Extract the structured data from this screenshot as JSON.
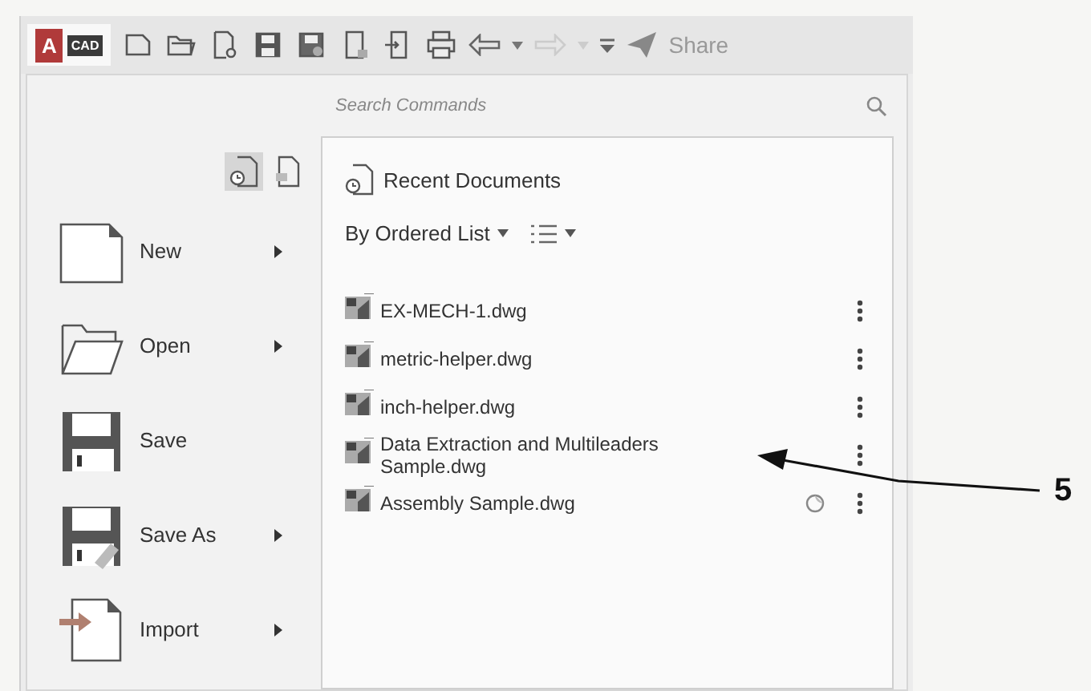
{
  "toolbar": {
    "logo": {
      "letter": "A",
      "badge": "CAD"
    },
    "undo": {
      "disabled": false
    },
    "redo": {
      "disabled": true
    },
    "share": "Share"
  },
  "search": {
    "placeholder": "Search Commands"
  },
  "view_toggles": [
    {
      "kind": "recent",
      "selected": true
    },
    {
      "kind": "open",
      "selected": false
    }
  ],
  "menu": [
    {
      "kind": "new",
      "label": "New",
      "submenu": true
    },
    {
      "kind": "open",
      "label": "Open",
      "submenu": true
    },
    {
      "kind": "save",
      "label": "Save",
      "submenu": false
    },
    {
      "kind": "save_as",
      "label": "Save As",
      "submenu": true
    },
    {
      "kind": "import",
      "label": "Import",
      "submenu": true
    }
  ],
  "recent": {
    "title": "Recent Documents",
    "sort": "By Ordered List",
    "files": [
      {
        "name": "EX-MECH-1.dwg",
        "pinned": false
      },
      {
        "name": "metric-helper.dwg",
        "pinned": false
      },
      {
        "name": "inch-helper.dwg",
        "pinned": false
      },
      {
        "name": "Data Extraction and Multileaders Sample.dwg",
        "pinned": false
      },
      {
        "name": "Assembly Sample.dwg",
        "pinned": true
      }
    ]
  },
  "callout": {
    "label": "5"
  }
}
